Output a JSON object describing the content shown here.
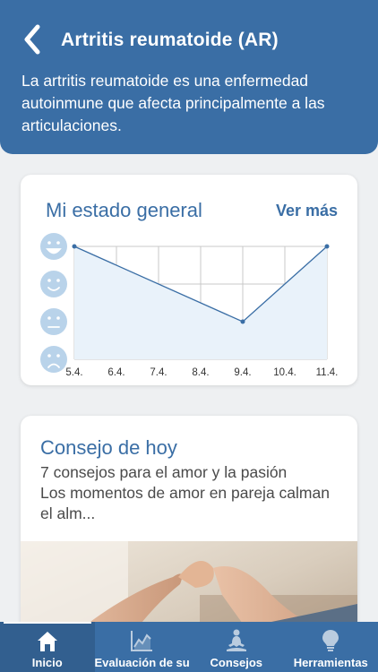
{
  "header": {
    "title": "Artritis reumatoide (AR)",
    "description": "La artritis reumatoide es una enfermedad autoinmune que afecta principalmente a las articulaciones.",
    "back_icon": "chevron-left-icon"
  },
  "status_card": {
    "title": "Mi estado general",
    "more_label": "Ver más",
    "mood_icons": [
      "very-happy-face-icon",
      "happy-face-icon",
      "neutral-face-icon",
      "sad-face-icon"
    ]
  },
  "chart_data": {
    "type": "line",
    "x": [
      "5.4.",
      "6.4.",
      "7.4.",
      "8.4.",
      "9.4.",
      "10.4.",
      "11.4."
    ],
    "series": [
      {
        "points": [
          {
            "x": "5.4.",
            "y": 4
          },
          {
            "x": "9.4.",
            "y": 2
          },
          {
            "x": "11.4.",
            "y": 4
          }
        ]
      }
    ],
    "y_scale": [
      "sad",
      "neutral",
      "happy",
      "very happy"
    ],
    "ylim": [
      1,
      4
    ],
    "grid": true,
    "colors": {
      "line": "#3a6ea5",
      "fill": "#e9f2fa",
      "face": "#b9d3ea"
    }
  },
  "tip_card": {
    "title": "Consejo de hoy",
    "subtitle": "7 consejos para el amor y la pasión",
    "body": "Los momentos de amor en pareja calman el alm..."
  },
  "tabbar": {
    "items": [
      {
        "label": "Inicio",
        "icon": "home-icon",
        "active": true
      },
      {
        "label": "Evaluación de su salud",
        "icon": "chart-icon",
        "active": false
      },
      {
        "label": "Consejos",
        "icon": "meditation-icon",
        "active": false
      },
      {
        "label": "Herramientas",
        "icon": "lightbulb-icon",
        "active": false
      }
    ]
  },
  "colors": {
    "brand": "#3a6ea5",
    "background": "#eef0f2"
  }
}
